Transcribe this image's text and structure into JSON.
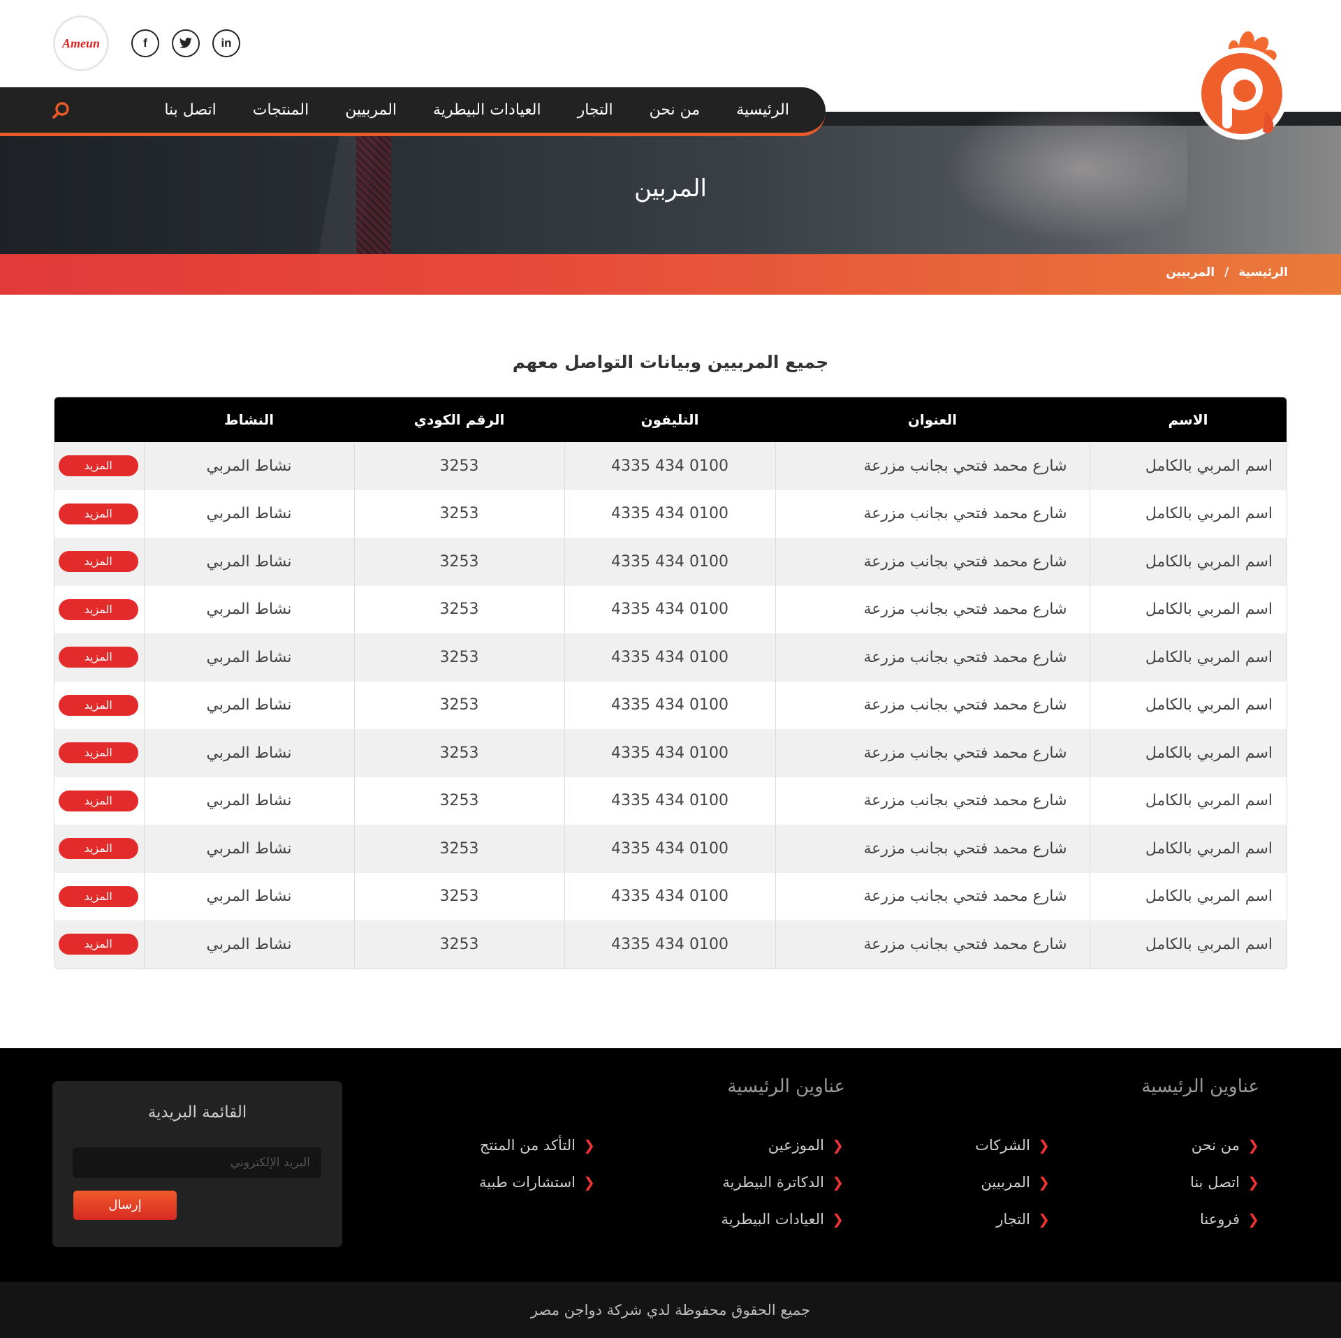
{
  "header": {
    "partner_logo_text": "Ameun",
    "social": [
      {
        "icon": "facebook-icon",
        "glyph": "f"
      },
      {
        "icon": "twitter-icon",
        "glyph": "t"
      },
      {
        "icon": "linkedin-icon",
        "glyph": "in"
      }
    ],
    "nav": [
      "الرئيسية",
      "من نحن",
      "التجار",
      "العيادات البيطرية",
      "المربيين",
      "المنتجات",
      "اتصل بنا"
    ],
    "brand_logo": "rooster-p-logo"
  },
  "hero": {
    "title": "المربين"
  },
  "breadcrumb": {
    "home": "الرئيسية",
    "separator": "/",
    "current": "المربيين"
  },
  "section": {
    "title": "جميع المربيين وبيانات التواصل معهم"
  },
  "table": {
    "headers": [
      "الاسم",
      "العنوان",
      "التليفون",
      "الرقم الكودي",
      "النشاط"
    ],
    "rows": [
      {
        "name": "اسم المربي بالكامل",
        "address": "شارع محمد فتحي بجانب مزرعة",
        "phone": "0100 434 4335",
        "code": "3253",
        "activity": "نشاط المربي",
        "action": "المزيد"
      },
      {
        "name": "اسم المربي بالكامل",
        "address": "شارع محمد فتحي بجانب مزرعة",
        "phone": "0100 434 4335",
        "code": "3253",
        "activity": "نشاط المربي",
        "action": "المزيد"
      },
      {
        "name": "اسم المربي بالكامل",
        "address": "شارع محمد فتحي بجانب مزرعة",
        "phone": "0100 434 4335",
        "code": "3253",
        "activity": "نشاط المربي",
        "action": "المزيد"
      },
      {
        "name": "اسم المربي بالكامل",
        "address": "شارع محمد فتحي بجانب مزرعة",
        "phone": "0100 434 4335",
        "code": "3253",
        "activity": "نشاط المربي",
        "action": "المزيد"
      },
      {
        "name": "اسم المربي بالكامل",
        "address": "شارع محمد فتحي بجانب مزرعة",
        "phone": "0100 434 4335",
        "code": "3253",
        "activity": "نشاط المربي",
        "action": "المزيد"
      },
      {
        "name": "اسم المربي بالكامل",
        "address": "شارع محمد فتحي بجانب مزرعة",
        "phone": "0100 434 4335",
        "code": "3253",
        "activity": "نشاط المربي",
        "action": "المزيد"
      },
      {
        "name": "اسم المربي بالكامل",
        "address": "شارع محمد فتحي بجانب مزرعة",
        "phone": "0100 434 4335",
        "code": "3253",
        "activity": "نشاط المربي",
        "action": "المزيد"
      },
      {
        "name": "اسم المربي بالكامل",
        "address": "شارع محمد فتحي بجانب مزرعة",
        "phone": "0100 434 4335",
        "code": "3253",
        "activity": "نشاط المربي",
        "action": "المزيد"
      },
      {
        "name": "اسم المربي بالكامل",
        "address": "شارع محمد فتحي بجانب مزرعة",
        "phone": "0100 434 4335",
        "code": "3253",
        "activity": "نشاط المربي",
        "action": "المزيد"
      },
      {
        "name": "اسم المربي بالكامل",
        "address": "شارع محمد فتحي بجانب مزرعة",
        "phone": "0100 434 4335",
        "code": "3253",
        "activity": "نشاط المربي",
        "action": "المزيد"
      },
      {
        "name": "اسم المربي بالكامل",
        "address": "شارع محمد فتحي بجانب مزرعة",
        "phone": "0100 434 4335",
        "code": "3253",
        "activity": "نشاط المربي",
        "action": "المزيد"
      }
    ]
  },
  "footer": {
    "col1_title": "عناوين الرئيسية",
    "col1_links": [
      "من نحن",
      "اتصل بنا",
      "فروعنا"
    ],
    "col2_links": [
      "الشركات",
      "المربيين",
      "التجار"
    ],
    "col3_title": "عناوين الرئيسية",
    "col3_links": [
      "الموزعين",
      "الدكاترة البيطرية",
      "العيادات البيطرية"
    ],
    "col4_links": [
      "التأكد من المنتج",
      "استشارات طبية"
    ],
    "newsletter": {
      "title": "القائمة البريدية",
      "placeholder": "البريد الإلكتروني",
      "button": "إرسال"
    },
    "copyright": "جميع الحقوق محفوظة لدي شركة دواجن مصر"
  },
  "colors": {
    "accent": "#e85a2a",
    "button_red": "#e32b2b",
    "nav_bg": "#222222",
    "footer_bg": "#000000"
  }
}
